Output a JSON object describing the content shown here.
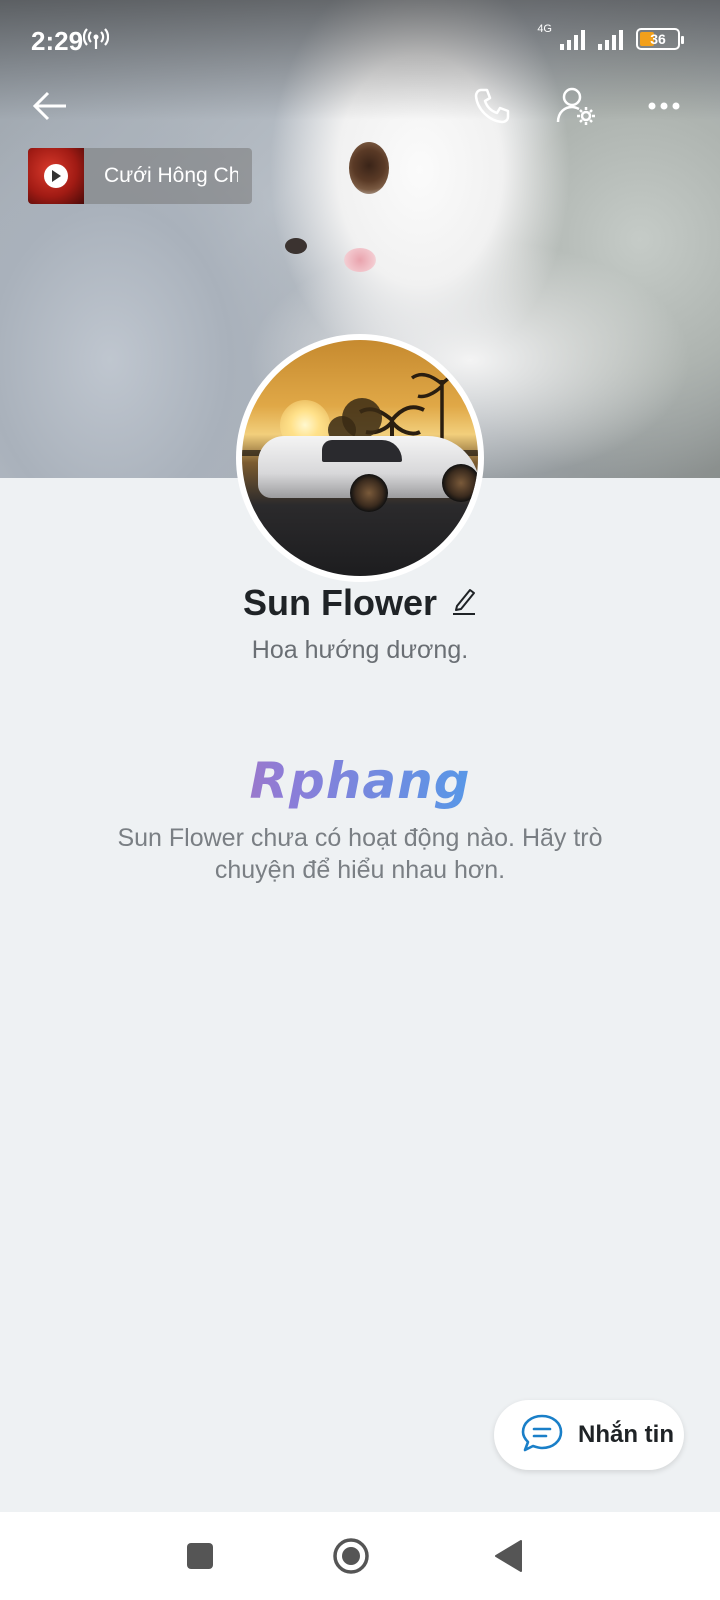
{
  "status_bar": {
    "time": "2:29",
    "network": "4G",
    "battery": "36"
  },
  "music": {
    "title": "Cưới Hông Ch"
  },
  "profile": {
    "name": "Sun Flower",
    "status": "Hoa hướng dương."
  },
  "watermark": "Rphang",
  "empty_state": {
    "message": "Sun Flower chưa có hoạt động nào. Hãy trò chuyện để hiểu nhau hơn."
  },
  "actions": {
    "message_label": "Nhắn tin"
  },
  "icons": {
    "back": "back-arrow-icon",
    "call": "phone-icon",
    "settings": "user-settings-icon",
    "more": "more-icon",
    "edit": "pencil-icon",
    "chat": "chat-bubble-icon"
  },
  "colors": {
    "accent": "#1a7fc8",
    "background": "#eef1f3",
    "battery": "#f2a01b"
  }
}
